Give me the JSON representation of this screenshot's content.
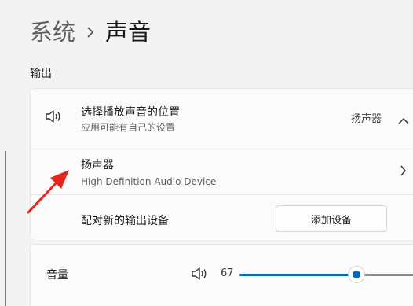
{
  "breadcrumb": {
    "parent": "系统",
    "current": "声音"
  },
  "output": {
    "section_label": "输出",
    "choose": {
      "title": "选择播放声音的位置",
      "subtitle": "应用可能有自己的设置",
      "value": "扬声器",
      "icon": "speaker-icon",
      "expanded": true
    },
    "device": {
      "name": "扬声器",
      "description": "High Definition Audio Device"
    },
    "pair": {
      "label": "配对新的输出设备",
      "button": "添加设备"
    }
  },
  "volume": {
    "label": "音量",
    "value": "67",
    "level": 0.67,
    "icon": "speaker-icon"
  },
  "colors": {
    "accent": "#0067c0",
    "annotation_arrow": "#e8241c"
  }
}
